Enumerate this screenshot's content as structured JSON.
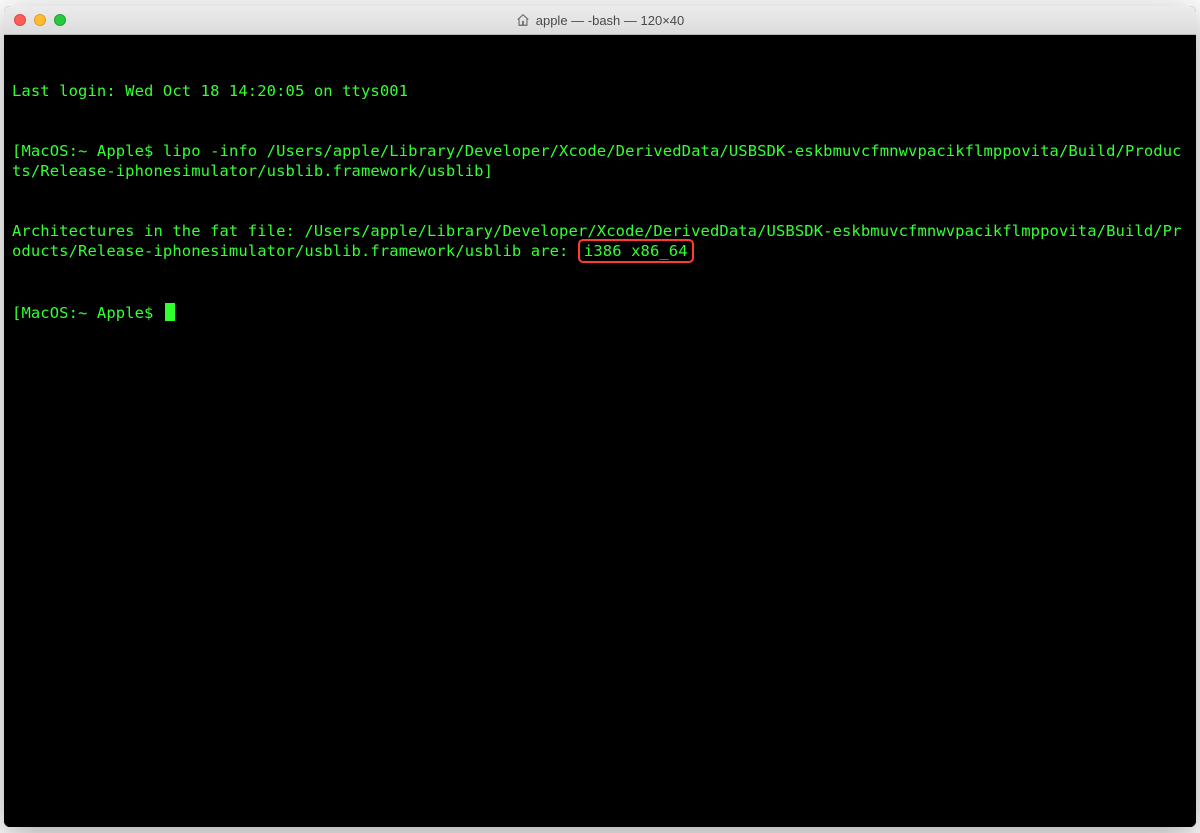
{
  "window": {
    "title": "apple — -bash — 120×40"
  },
  "terminal": {
    "login_line": "Last login: Wed Oct 18 14:20:05 on ttys001",
    "prompt1_prefix": "MacOS:~ Apple$ ",
    "cmd1": "lipo -info /Users/apple/Library/Developer/Xcode/DerivedData/USBSDK-eskbmuvcfmnwvpacikflmppovita/Build/Products/Release-iphonesimulator/usblib.framework/usblib",
    "out1_prefix": "Architectures in the fat file: /Users/apple/Library/Developer/Xcode/DerivedData/USBSDK-eskbmuvcfmnwvpacikflmppovita/Build/Products/Release-iphonesimulator/usblib.framework/usblib are: ",
    "out1_highlight": "i386 x86_64",
    "prompt2": "MacOS:~ Apple$ "
  },
  "colors": {
    "terminal_fg": "#33ff33",
    "terminal_bg": "#000000",
    "highlight_border": "#ff3b30",
    "traffic_red": "#ff5f57",
    "traffic_yellow": "#febc2e",
    "traffic_green": "#28c840"
  }
}
